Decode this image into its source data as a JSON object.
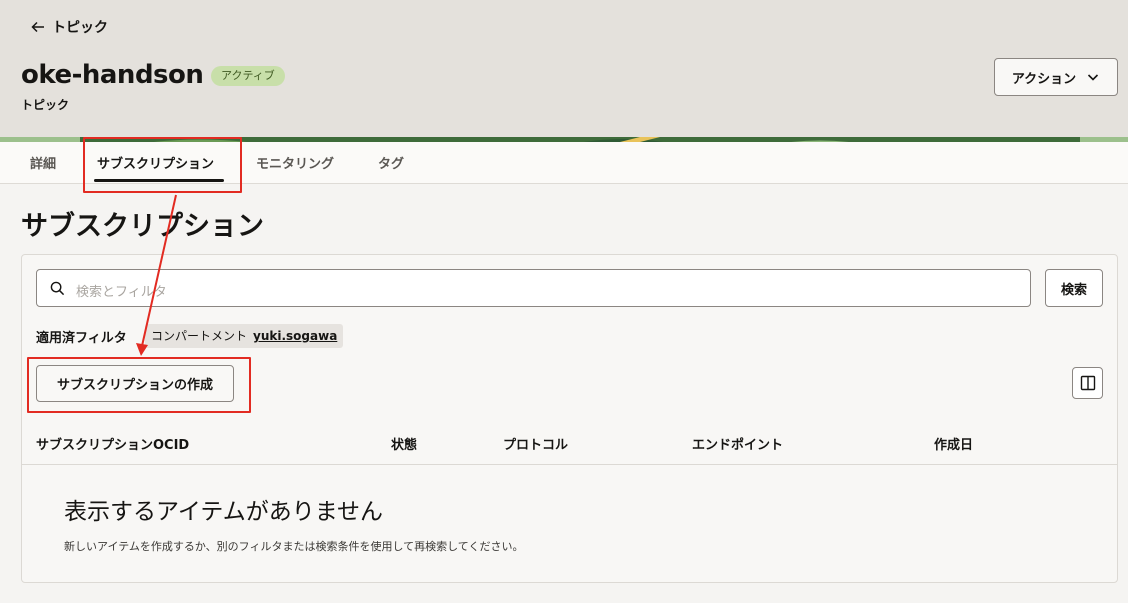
{
  "breadcrumb": {
    "label": "トピック"
  },
  "resource": {
    "name": "oke-handson",
    "status": "アクティブ",
    "type": "トピック"
  },
  "actions": {
    "label": "アクション"
  },
  "tabs": [
    {
      "label": "詳細"
    },
    {
      "label": "サブスクリプション"
    },
    {
      "label": "モニタリング"
    },
    {
      "label": "タグ"
    }
  ],
  "section": {
    "title": "サブスクリプション"
  },
  "search": {
    "placeholder": "検索とフィルタ",
    "button": "検索"
  },
  "filters": {
    "label": "適用済フィルタ",
    "chip_key": "コンパートメント",
    "chip_value": "yuki.sogawa"
  },
  "create_button": "サブスクリプションの作成",
  "table": {
    "columns": [
      "サブスクリプションOCID",
      "状態",
      "プロトコル",
      "エンドポイント",
      "作成日"
    ]
  },
  "empty": {
    "title": "表示するアイテムがありません",
    "description": "新しいアイテムを作成するか、別のフィルタまたは検索条件を使用して再検索してください。"
  },
  "colors": {
    "highlight": "#e22b22",
    "badge_bg": "#c8dfa9",
    "badge_text": "#3f5a22"
  }
}
